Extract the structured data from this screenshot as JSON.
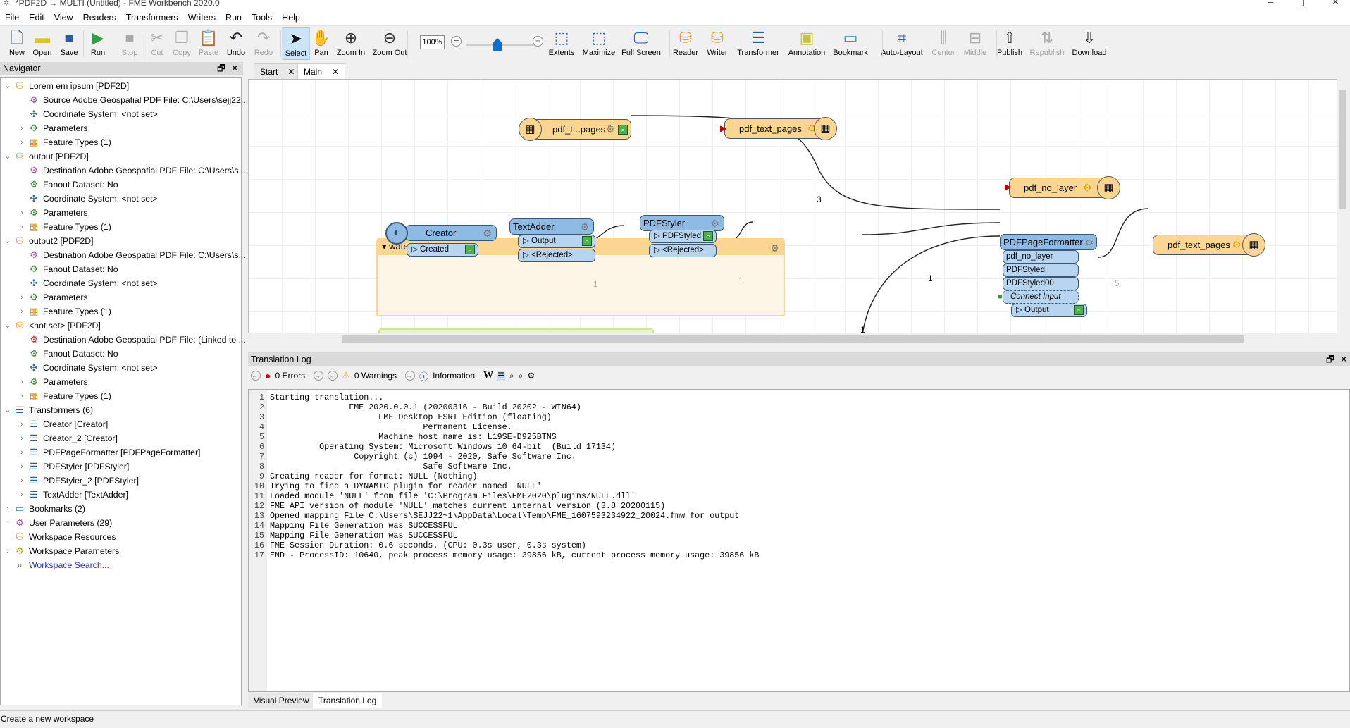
{
  "window": {
    "title": "*PDF2D → MULTI (Untitled) - FME Workbench 2020.0",
    "minimize": "–",
    "maximize": "▯",
    "close": "✕"
  },
  "menu": [
    "File",
    "Edit",
    "View",
    "Readers",
    "Transformers",
    "Writers",
    "Run",
    "Tools",
    "Help"
  ],
  "toolbar": {
    "buttons": [
      {
        "label": "New",
        "icon": "new-file-icon",
        "enabled": true
      },
      {
        "label": "Open",
        "icon": "folder-icon",
        "enabled": true
      },
      {
        "label": "Save",
        "icon": "floppy-icon",
        "enabled": true
      },
      {
        "label": "Run",
        "icon": "play-icon",
        "enabled": true
      },
      {
        "label": "Stop",
        "icon": "stop-icon",
        "enabled": false
      },
      {
        "label": "Cut",
        "icon": "scissors-icon",
        "enabled": false
      },
      {
        "label": "Copy",
        "icon": "copy-icon",
        "enabled": false
      },
      {
        "label": "Paste",
        "icon": "clipboard-icon",
        "enabled": false
      },
      {
        "label": "Undo",
        "icon": "undo-icon",
        "enabled": true
      },
      {
        "label": "Redo",
        "icon": "redo-icon",
        "enabled": false
      },
      {
        "label": "Select",
        "icon": "cursor-icon",
        "enabled": true,
        "active": true
      },
      {
        "label": "Pan",
        "icon": "hand-icon",
        "enabled": true
      },
      {
        "label": "Zoom In",
        "icon": "zoom-in-icon",
        "enabled": true
      },
      {
        "label": "Zoom Out",
        "icon": "zoom-out-icon",
        "enabled": true
      },
      {
        "label": "Extents",
        "icon": "extents-icon",
        "enabled": true
      },
      {
        "label": "Maximize",
        "icon": "maximize-icon",
        "enabled": true
      },
      {
        "label": "Full Screen",
        "icon": "full-screen-icon",
        "enabled": true
      },
      {
        "label": "Reader",
        "icon": "add-reader-icon",
        "enabled": true
      },
      {
        "label": "Writer",
        "icon": "add-writer-icon",
        "enabled": true
      },
      {
        "label": "Transformer",
        "icon": "add-transformer-icon",
        "enabled": true
      },
      {
        "label": "Annotation",
        "icon": "add-annotation-icon",
        "enabled": true
      },
      {
        "label": "Bookmark",
        "icon": "add-bookmark-icon",
        "enabled": true
      },
      {
        "label": "Auto-Layout",
        "icon": "auto-layout-icon",
        "enabled": true
      },
      {
        "label": "Center",
        "icon": "align-center-icon",
        "enabled": false
      },
      {
        "label": "Middle",
        "icon": "align-middle-icon",
        "enabled": false
      },
      {
        "label": "Publish",
        "icon": "publish-icon",
        "enabled": true
      },
      {
        "label": "Republish",
        "icon": "republish-icon",
        "enabled": false
      },
      {
        "label": "Download",
        "icon": "download-icon",
        "enabled": true
      }
    ],
    "zoom_level": "100%",
    "zoom_slider_fraction": 0.5
  },
  "navigator": {
    "title": "Navigator",
    "items": [
      {
        "level": 0,
        "exp": "open",
        "icon": "reader-icon",
        "text": "Lorem em ipsum [PDF2D]"
      },
      {
        "level": 1,
        "exp": "none",
        "icon": "user-param-icon",
        "text": "Source Adobe Geospatial PDF File: C:\\Users\\sejj22..."
      },
      {
        "level": 1,
        "exp": "none",
        "icon": "coordinate-system-icon",
        "text": "Coordinate System: <not set>"
      },
      {
        "level": 1,
        "exp": "closed",
        "icon": "gear-icon",
        "text": "Parameters"
      },
      {
        "level": 1,
        "exp": "closed",
        "icon": "feature-type-icon",
        "text": "Feature Types (1)"
      },
      {
        "level": 0,
        "exp": "open",
        "icon": "writer-icon",
        "text": "output [PDF2D]"
      },
      {
        "level": 1,
        "exp": "none",
        "icon": "user-param-icon",
        "text": "Destination Adobe Geospatial PDF File: C:\\Users\\s..."
      },
      {
        "level": 1,
        "exp": "none",
        "icon": "gear-icon",
        "text": "Fanout Dataset: No"
      },
      {
        "level": 1,
        "exp": "none",
        "icon": "coordinate-system-icon",
        "text": "Coordinate System: <not set>"
      },
      {
        "level": 1,
        "exp": "closed",
        "icon": "gear-icon",
        "text": "Parameters"
      },
      {
        "level": 1,
        "exp": "closed",
        "icon": "feature-type-icon",
        "text": "Feature Types (1)"
      },
      {
        "level": 0,
        "exp": "open",
        "icon": "writer-icon",
        "text": "output2 [PDF2D]"
      },
      {
        "level": 1,
        "exp": "none",
        "icon": "user-param-icon",
        "text": "Destination Adobe Geospatial PDF File: C:\\Users\\s..."
      },
      {
        "level": 1,
        "exp": "none",
        "icon": "gear-icon",
        "text": "Fanout Dataset: No"
      },
      {
        "level": 1,
        "exp": "none",
        "icon": "coordinate-system-icon",
        "text": "Coordinate System: <not set>"
      },
      {
        "level": 1,
        "exp": "closed",
        "icon": "gear-icon",
        "text": "Parameters"
      },
      {
        "level": 1,
        "exp": "closed",
        "icon": "feature-type-icon",
        "text": "Feature Types (1)"
      },
      {
        "level": 0,
        "exp": "open",
        "icon": "writer-icon",
        "text": "<not set> [PDF2D]"
      },
      {
        "level": 1,
        "exp": "none",
        "icon": "error-param-icon",
        "text": "Destination Adobe Geospatial PDF File: (Linked to ..."
      },
      {
        "level": 1,
        "exp": "none",
        "icon": "gear-icon",
        "text": "Fanout Dataset: No"
      },
      {
        "level": 1,
        "exp": "none",
        "icon": "coordinate-system-icon",
        "text": "Coordinate System: <not set>"
      },
      {
        "level": 1,
        "exp": "closed",
        "icon": "gear-icon",
        "text": "Parameters"
      },
      {
        "level": 1,
        "exp": "closed",
        "icon": "feature-type-icon",
        "text": "Feature Types (1)"
      },
      {
        "level": 0,
        "exp": "open",
        "icon": "transformer-icon",
        "text": "Transformers (6)"
      },
      {
        "level": 1,
        "exp": "closed",
        "icon": "transformer-icon",
        "text": "Creator [Creator]"
      },
      {
        "level": 1,
        "exp": "closed",
        "icon": "transformer-icon",
        "text": "Creator_2 [Creator]"
      },
      {
        "level": 1,
        "exp": "closed",
        "icon": "transformer-icon",
        "text": "PDFPageFormatter [PDFPageFormatter]"
      },
      {
        "level": 1,
        "exp": "closed",
        "icon": "transformer-icon",
        "text": "PDFStyler [PDFStyler]"
      },
      {
        "level": 1,
        "exp": "closed",
        "icon": "transformer-icon",
        "text": "PDFStyler_2 [PDFStyler]"
      },
      {
        "level": 1,
        "exp": "closed",
        "icon": "transformer-icon",
        "text": "TextAdder [TextAdder]"
      },
      {
        "level": 0,
        "exp": "closed",
        "icon": "bookmark-icon",
        "text": "Bookmarks (2)"
      },
      {
        "level": 0,
        "exp": "closed",
        "icon": "user-param-icon",
        "text": "User Parameters (29)"
      },
      {
        "level": 0,
        "exp": "none",
        "icon": "resources-icon",
        "text": "Workspace Resources"
      },
      {
        "level": 0,
        "exp": "closed",
        "icon": "workspace-params-icon",
        "text": "Workspace Parameters"
      },
      {
        "level": 0,
        "exp": "none",
        "icon": "search-icon",
        "text": "Workspace Search...",
        "link": true
      }
    ]
  },
  "tabs": [
    {
      "label": "Start",
      "active": false
    },
    {
      "label": "Main",
      "active": true
    }
  ],
  "canvas": {
    "reader_ft": {
      "name": "pdf_t...pages"
    },
    "writer_ft1": {
      "name": "pdf_text_pages"
    },
    "writer_ft2": {
      "name": "pdf_no_layer"
    },
    "writer_ft3": {
      "name": "pdf_text_pages"
    },
    "bookmark": {
      "title": "watermark text"
    },
    "creator": {
      "name": "Creator",
      "ports": [
        "Created"
      ]
    },
    "textadder": {
      "name": "TextAdder",
      "ports": [
        "Output",
        "<Rejected>"
      ]
    },
    "pdfstyler": {
      "name": "PDFStyler",
      "ports": [
        "PDFStyled",
        "<Rejected>"
      ]
    },
    "formatter": {
      "name": "PDFPageFormatter",
      "inputs": [
        "pdf_no_layer",
        "PDFStyled",
        "PDFStyled00"
      ],
      "connect": "Connect Input",
      "output": "Output"
    },
    "counts": {
      "reader_to_formatter": "3",
      "creator_to_textadder": "1",
      "textadder_to_styler": "1",
      "styler_to_formatter": "1",
      "other_to_formatter": "1",
      "formatter_to_writer": "5"
    }
  },
  "log": {
    "title": "Translation Log",
    "errors": "0 Errors",
    "warnings": "0 Warnings",
    "information": "Information",
    "lines": [
      "Starting translation...",
      "                FME 2020.0.0.1 (20200316 - Build 20202 - WIN64)",
      "                      FME Desktop ESRI Edition (floating)",
      "                               Permanent License.",
      "                      Machine host name is: L19SE-D925BTNS",
      "          Operating System: Microsoft Windows 10 64-bit  (Build 17134)",
      "                 Copyright (c) 1994 - 2020, Safe Software Inc.",
      "                               Safe Software Inc.",
      "Creating reader for format: NULL (Nothing)",
      "Trying to find a DYNAMIC plugin for reader named `NULL'",
      "Loaded module 'NULL' from file 'C:\\Program Files\\FME2020\\plugins/NULL.dll'",
      "FME API version of module 'NULL' matches current internal version (3.8 20200115)",
      "Opened mapping File C:\\Users\\SEJJ22~1\\AppData\\Local\\Temp\\FME_1607593234922_20024.fmw for output",
      "Mapping File Generation was SUCCESSFUL",
      "Mapping File Generation was SUCCESSFUL",
      "FME Session Duration: 0.6 seconds. (CPU: 0.3s user, 0.3s system)",
      "END - ProcessID: 10640, peak process memory usage: 39856 kB, current process memory usage: 39856 kB"
    ]
  },
  "bottom_tabs": [
    {
      "label": "Visual Preview",
      "active": false
    },
    {
      "label": "Translation Log",
      "active": true
    }
  ],
  "status": "Create a new workspace",
  "colors": {
    "feature_type": "#fbd592",
    "transformer": "#8fbae3",
    "port": "#b7d5f0",
    "select_active": "#cce4f7",
    "link": "#1a3cc7"
  }
}
